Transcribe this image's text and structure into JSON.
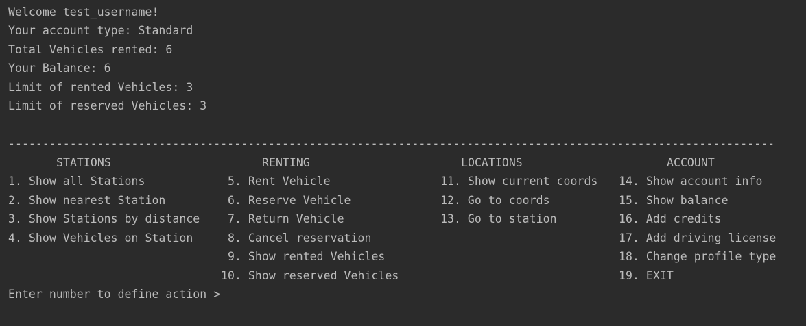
{
  "info": {
    "welcome": "Welcome test_username!",
    "account_type": "Your account type: Standard",
    "total_rented": "Total Vehicles rented: 6",
    "balance": "Your Balance: 6",
    "limit_rented": "Limit of rented Vehicles: 3",
    "limit_reserved": "Limit of reserved Vehicles: 3"
  },
  "separator": "------------------------------------------------------------------------------------------------------------------",
  "menu": {
    "stations": {
      "header": "STATIONS",
      "items": [
        "1. Show all Stations",
        "2. Show nearest Station",
        "3. Show Stations by distance",
        "4. Show Vehicles on Station"
      ]
    },
    "renting": {
      "header": "RENTING",
      "items": [
        "5. Rent Vehicle",
        "6. Reserve Vehicle",
        "7. Return Vehicle",
        "8. Cancel reservation",
        "9. Show rented Vehicles",
        "10. Show reserved Vehicles"
      ]
    },
    "locations": {
      "header": "LOCATIONS",
      "items": [
        "11. Show current coords",
        "12. Go to coords",
        "13. Go to station"
      ]
    },
    "account": {
      "header": "ACCOUNT",
      "items": [
        "14. Show account info",
        "15. Show balance",
        "16. Add credits",
        "17. Add driving license",
        "18. Change profile type",
        "19. EXIT"
      ]
    }
  },
  "prompt": "Enter number to define action >"
}
